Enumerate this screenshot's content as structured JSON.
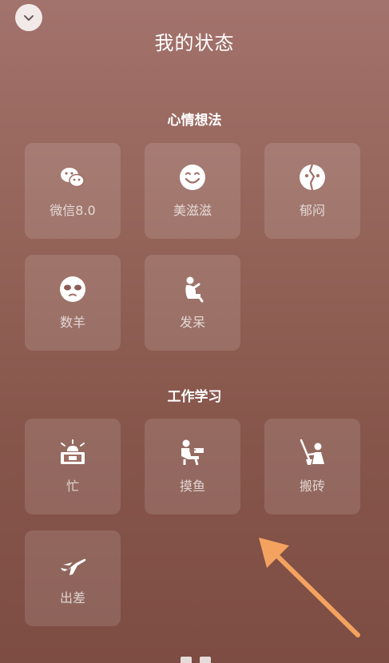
{
  "header": {
    "title": "我的状态"
  },
  "sections": [
    {
      "title": "心情想法",
      "items": [
        {
          "label": "微信8.0",
          "icon": "wechat-icon"
        },
        {
          "label": "美滋滋",
          "icon": "smile-face-icon"
        },
        {
          "label": "郁闷",
          "icon": "broken-heart-face-icon"
        },
        {
          "label": "数羊",
          "icon": "sleepy-face-icon"
        },
        {
          "label": "发呆",
          "icon": "daze-person-icon"
        }
      ]
    },
    {
      "title": "工作学习",
      "items": [
        {
          "label": "忙",
          "icon": "alarm-laptop-icon"
        },
        {
          "label": "摸鱼",
          "icon": "relax-person-icon"
        },
        {
          "label": "搬砖",
          "icon": "worker-shovel-icon"
        },
        {
          "label": "出差",
          "icon": "airplane-icon"
        }
      ]
    }
  ],
  "colors": {
    "arrow": "#f3a35f",
    "tile_bg": "rgba(255,255,255,0.12)",
    "background_top": "#a2726c",
    "background_bottom": "#7d4c43"
  }
}
